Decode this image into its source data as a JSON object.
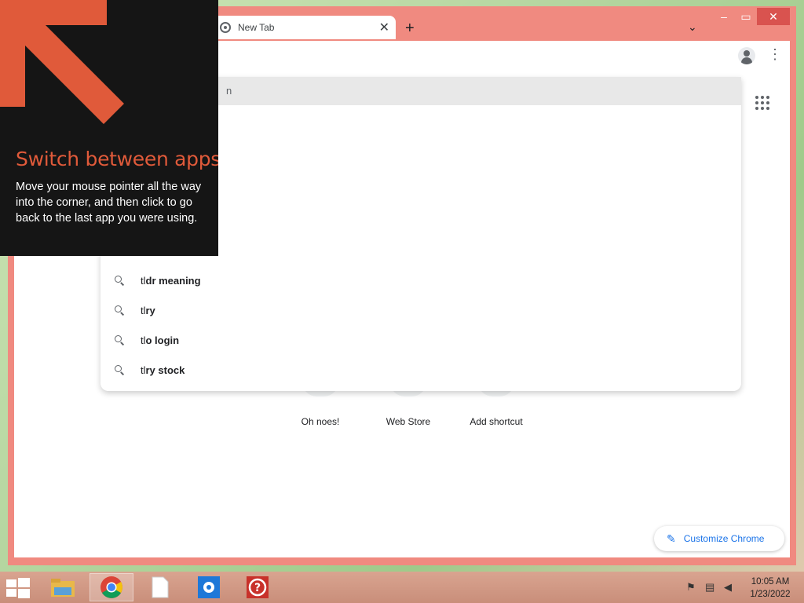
{
  "window": {
    "minimize_icon": "minimize-icon",
    "maximize_icon": "maximize-icon",
    "close_icon": "close-icon",
    "minimize_glyph": "–",
    "maximize_glyph": "▭",
    "close_glyph": "✕"
  },
  "tab": {
    "title": "New Tab",
    "close_glyph": "✕",
    "new_tab_glyph": "+",
    "tab_search_glyph": "⌄"
  },
  "toolbar": {
    "menu_glyph": "⋮"
  },
  "omnibox": {
    "highlight_text": "n",
    "suggestions": [
      {
        "typed": "tl",
        "completion": "dr meaning"
      },
      {
        "typed": "tl",
        "completion": "ry"
      },
      {
        "typed": "tl",
        "completion": "o login"
      },
      {
        "typed": "tl",
        "completion": "ry stock"
      }
    ]
  },
  "shortcuts": [
    {
      "label": "Oh noes!"
    },
    {
      "label": "Web Store"
    },
    {
      "label": "Add shortcut"
    }
  ],
  "customize": {
    "label": "Customize Chrome",
    "icon_glyph": "✎"
  },
  "tooltip": {
    "title": "Switch between apps",
    "body": "Move your mouse pointer all the way into the corner, and then click to go back to the last app you were using."
  },
  "taskbar": {
    "apps": [
      "file-explorer-icon",
      "chrome-icon",
      "notepad-icon",
      "settings-icon",
      "help-icon"
    ],
    "clock": {
      "time": "10:05 AM",
      "date": "1/23/2022"
    }
  },
  "colors": {
    "window_frame": "#f08a80",
    "tooltip_accent": "#e05a3a",
    "link_blue": "#1a73e8"
  }
}
